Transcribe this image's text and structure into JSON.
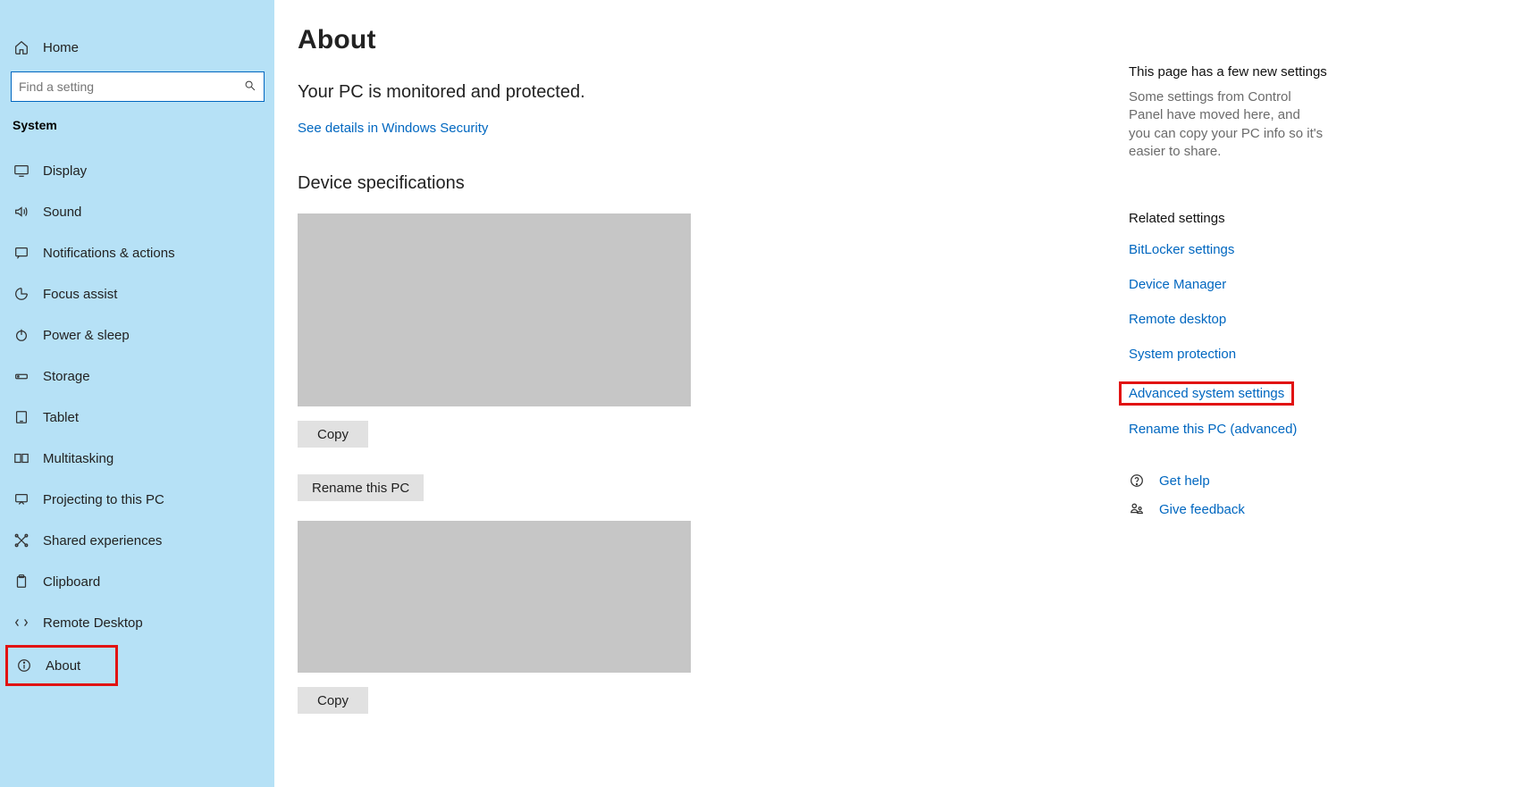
{
  "sidebar": {
    "home": "Home",
    "search_placeholder": "Find a setting",
    "category": "System",
    "items": [
      {
        "label": "Display"
      },
      {
        "label": "Sound"
      },
      {
        "label": "Notifications & actions"
      },
      {
        "label": "Focus assist"
      },
      {
        "label": "Power & sleep"
      },
      {
        "label": "Storage"
      },
      {
        "label": "Tablet"
      },
      {
        "label": "Multitasking"
      },
      {
        "label": "Projecting to this PC"
      },
      {
        "label": "Shared experiences"
      },
      {
        "label": "Clipboard"
      },
      {
        "label": "Remote Desktop"
      },
      {
        "label": "About"
      }
    ]
  },
  "main": {
    "title": "About",
    "protected": "Your PC is monitored and protected.",
    "security_link": "See details in Windows Security",
    "device_spec_heading": "Device specifications",
    "copy_label": "Copy",
    "rename_label": "Rename this PC"
  },
  "right": {
    "tip_title": "This page has a few new settings",
    "tip_body": "Some settings from Control Panel have moved here, and you can copy your PC info so it's easier to share.",
    "related_heading": "Related settings",
    "links": {
      "bitlocker": "BitLocker settings",
      "devmgr": "Device Manager",
      "remote": "Remote desktop",
      "sysprot": "System protection",
      "advsys": "Advanced system settings",
      "rename_adv": "Rename this PC (advanced)"
    },
    "support": {
      "help": "Get help",
      "feedback": "Give feedback"
    }
  }
}
